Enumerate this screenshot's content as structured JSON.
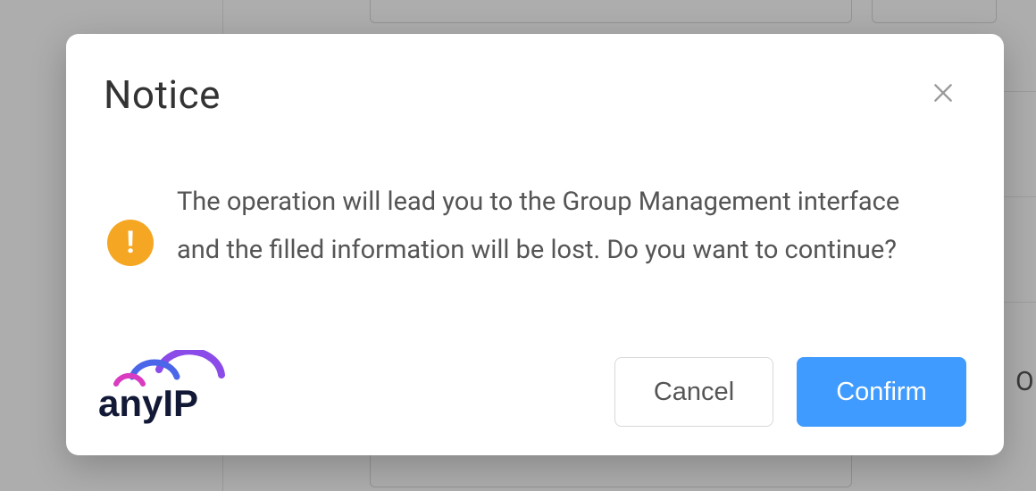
{
  "modal": {
    "title": "Notice",
    "message": "The operation will lead you to the Group Management interface and the filled information will be lost. Do you want to continue?",
    "cancel_label": "Cancel",
    "confirm_label": "Confirm"
  },
  "background": {
    "partial_text_right": "ON"
  },
  "logo": {
    "text": "anyIP"
  }
}
